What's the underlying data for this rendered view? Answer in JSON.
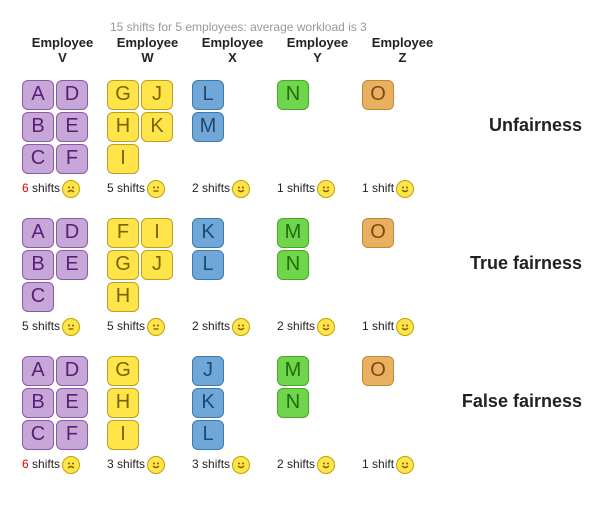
{
  "subtitle": "15 shifts for 5 employees: average workload is 3",
  "employees": [
    {
      "key": "V",
      "label_top": "Employee",
      "label_bot": "V",
      "color": "purple"
    },
    {
      "key": "W",
      "label_top": "Employee",
      "label_bot": "W",
      "color": "yellow"
    },
    {
      "key": "X",
      "label_top": "Employee",
      "label_bot": "X",
      "color": "blue"
    },
    {
      "key": "Y",
      "label_top": "Employee",
      "label_bot": "Y",
      "color": "green"
    },
    {
      "key": "Z",
      "label_top": "Employee",
      "label_bot": "Z",
      "color": "orange"
    }
  ],
  "scenarios": [
    {
      "label": "Unfairness",
      "assign": {
        "V": [
          "A",
          "D",
          "B",
          "E",
          "C",
          "F"
        ],
        "W": [
          "G",
          "J",
          "H",
          "K",
          "I"
        ],
        "X": [
          "L",
          "M"
        ],
        "Y": [
          "N"
        ],
        "Z": [
          "O"
        ]
      },
      "summary": {
        "V": {
          "text_pre": "6",
          "text_post": " shifts",
          "red": true,
          "mood": "sad"
        },
        "W": {
          "text_pre": "5",
          "text_post": " shifts",
          "red": false,
          "mood": "neutral"
        },
        "X": {
          "text_pre": "2",
          "text_post": " shifts",
          "red": false,
          "mood": "happy"
        },
        "Y": {
          "text_pre": "1",
          "text_post": " shifts",
          "red": false,
          "mood": "happy"
        },
        "Z": {
          "text_pre": "1",
          "text_post": " shift",
          "red": false,
          "mood": "happy"
        }
      }
    },
    {
      "label": "True fairness",
      "assign": {
        "V": [
          "A",
          "D",
          "B",
          "E",
          "C"
        ],
        "W": [
          "F",
          "I",
          "G",
          "J",
          "H"
        ],
        "X": [
          "K",
          "L"
        ],
        "Y": [
          "M",
          "N"
        ],
        "Z": [
          "O"
        ]
      },
      "summary": {
        "V": {
          "text_pre": "5",
          "text_post": " shifts",
          "red": false,
          "mood": "neutral"
        },
        "W": {
          "text_pre": "5",
          "text_post": " shifts",
          "red": false,
          "mood": "neutral"
        },
        "X": {
          "text_pre": "2",
          "text_post": " shifts",
          "red": false,
          "mood": "happy"
        },
        "Y": {
          "text_pre": "2",
          "text_post": " shifts",
          "red": false,
          "mood": "happy"
        },
        "Z": {
          "text_pre": "1",
          "text_post": " shift",
          "red": false,
          "mood": "happy"
        }
      }
    },
    {
      "label": "False fairness",
      "assign": {
        "V": [
          "A",
          "D",
          "B",
          "E",
          "C",
          "F"
        ],
        "W": [
          "G",
          "H",
          "I"
        ],
        "X": [
          "J",
          "K",
          "L"
        ],
        "Y": [
          "M",
          "N"
        ],
        "Z": [
          "O"
        ]
      },
      "summary": {
        "V": {
          "text_pre": "6",
          "text_post": " shifts",
          "red": true,
          "mood": "sad"
        },
        "W": {
          "text_pre": "3",
          "text_post": " shifts",
          "red": false,
          "mood": "happy"
        },
        "X": {
          "text_pre": "3",
          "text_post": " shifts",
          "red": false,
          "mood": "happy"
        },
        "Y": {
          "text_pre": "2",
          "text_post": " shifts",
          "red": false,
          "mood": "happy"
        },
        "Z": {
          "text_pre": "1",
          "text_post": " shift",
          "red": false,
          "mood": "happy"
        }
      }
    }
  ],
  "chart_data": {
    "type": "table",
    "title": "15 shifts for 5 employees: average workload is 3",
    "employees": [
      "V",
      "W",
      "X",
      "Y",
      "Z"
    ],
    "scenarios": [
      {
        "name": "Unfairness",
        "shift_counts": {
          "V": 6,
          "W": 5,
          "X": 2,
          "Y": 1,
          "Z": 1
        },
        "mood": {
          "V": "sad",
          "W": "neutral",
          "X": "happy",
          "Y": "happy",
          "Z": "happy"
        }
      },
      {
        "name": "True fairness",
        "shift_counts": {
          "V": 5,
          "W": 5,
          "X": 2,
          "Y": 2,
          "Z": 1
        },
        "mood": {
          "V": "neutral",
          "W": "neutral",
          "X": "happy",
          "Y": "happy",
          "Z": "happy"
        }
      },
      {
        "name": "False fairness",
        "shift_counts": {
          "V": 6,
          "W": 3,
          "X": 3,
          "Y": 2,
          "Z": 1
        },
        "mood": {
          "V": "sad",
          "W": "happy",
          "X": "happy",
          "Y": "happy",
          "Z": "happy"
        }
      }
    ],
    "average_workload": 3,
    "total_shifts": 15
  }
}
